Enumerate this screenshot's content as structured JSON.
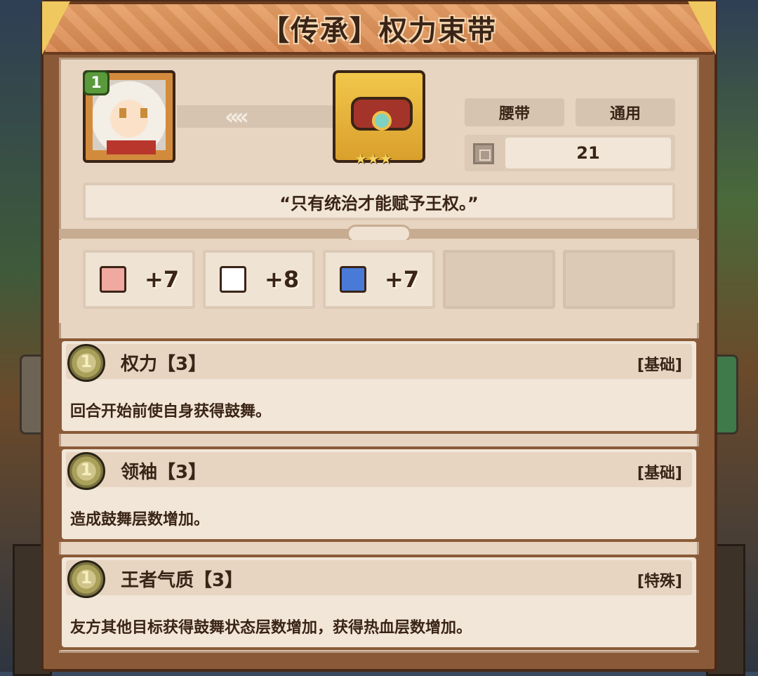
{
  "title": "【传承】权力束带",
  "hero": {
    "level": "1",
    "icon": "hero-portrait"
  },
  "item": {
    "icon": "belt-icon",
    "stars": "★★★"
  },
  "tags": {
    "slot": "腰带",
    "class": "通用"
  },
  "count": {
    "icon": "grid-icon",
    "value": "21"
  },
  "quote": "“只有统治才能赋予王权。”",
  "stats": [
    {
      "icon": "fist-icon",
      "value": "+7",
      "color": "#f0a9a0"
    },
    {
      "icon": "book-icon",
      "value": "+8",
      "color": "#ffffff"
    },
    {
      "icon": "boot-icon",
      "value": "+7",
      "color": "#4a7ad8"
    }
  ],
  "traits": [
    {
      "name": "权力【3】",
      "type": "[基础]",
      "desc": "回合开始前使自身获得鼓舞。"
    },
    {
      "name": "领袖【3】",
      "type": "[基础]",
      "desc": "造成鼓舞层数增加。"
    },
    {
      "name": "王者气质【3】",
      "type": "[特殊]",
      "desc": "友方其他目标获得鼓舞状态层数增加，获得热血层数增加。"
    }
  ]
}
